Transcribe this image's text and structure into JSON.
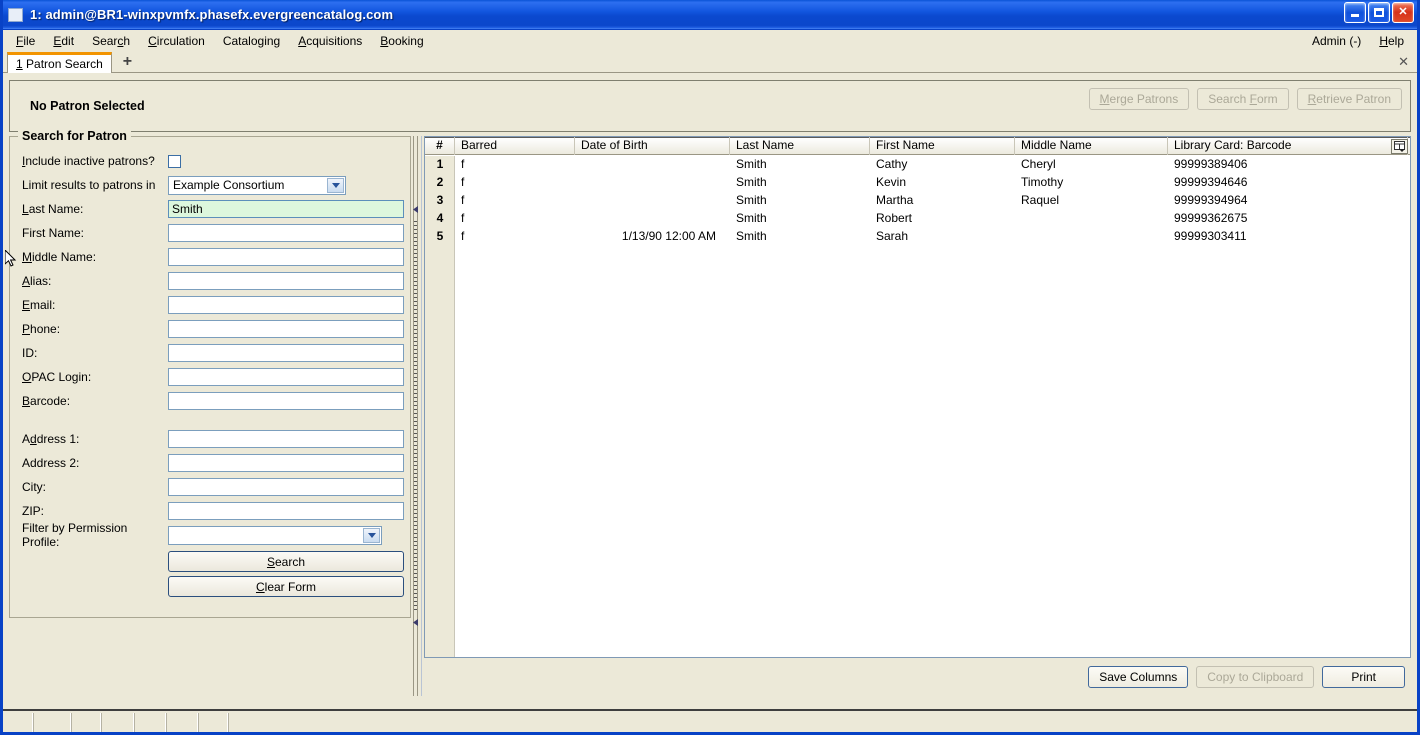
{
  "window": {
    "title": "1: admin@BR1-winxpvmfx.phasefx.evergreencatalog.com",
    "minimize_label": "Minimize",
    "maximize_label": "Maximize",
    "close_label": "✕"
  },
  "menubar": {
    "items": [
      {
        "label": "File",
        "accel": "F"
      },
      {
        "label": "Edit",
        "accel": "E"
      },
      {
        "label": "Search",
        "accel": "c"
      },
      {
        "label": "Circulation",
        "accel": "C"
      },
      {
        "label": "Cataloging",
        "accel": "g"
      },
      {
        "label": "Acquisitions",
        "accel": "A"
      },
      {
        "label": "Booking",
        "accel": "B"
      }
    ],
    "right": [
      {
        "label": "Admin (-)"
      },
      {
        "label": "Help",
        "accel": "H"
      }
    ]
  },
  "tabs": {
    "active": {
      "number": "1",
      "label": "Patron Search"
    },
    "new_tab_label": "+",
    "close_label": "✕"
  },
  "patron_header": {
    "status": "No Patron Selected",
    "buttons": [
      {
        "label": "Merge Patrons",
        "accel": "M",
        "enabled": false
      },
      {
        "label": "Search Form",
        "accel": "F",
        "enabled": false
      },
      {
        "label": "Retrieve Patron",
        "accel": "R",
        "enabled": false
      }
    ]
  },
  "search_form": {
    "legend": "Search for Patron",
    "fields": {
      "include_inactive": {
        "label": "Include inactive patrons?",
        "accel": "I",
        "type": "checkbox",
        "checked": false
      },
      "limit_org": {
        "label": "Limit results to patrons in",
        "type": "select",
        "value": "Example Consortium"
      },
      "last_name": {
        "label": "Last Name:",
        "accel": "L",
        "value": "Smith",
        "focused": true
      },
      "first_name": {
        "label": "First Name:",
        "value": ""
      },
      "middle_name": {
        "label": "Middle Name:",
        "accel": "M",
        "value": ""
      },
      "alias": {
        "label": "Alias:",
        "accel": "A",
        "value": ""
      },
      "email": {
        "label": "Email:",
        "accel": "E",
        "value": ""
      },
      "phone": {
        "label": "Phone:",
        "accel": "P",
        "value": ""
      },
      "id": {
        "label": "ID:",
        "value": ""
      },
      "opac_login": {
        "label": "OPAC Login:",
        "accel": "O",
        "value": ""
      },
      "barcode": {
        "label": "Barcode:",
        "accel": "B",
        "value": ""
      },
      "address1": {
        "label": "Address 1:",
        "accel": "d",
        "value": ""
      },
      "address2": {
        "label": "Address 2:",
        "value": ""
      },
      "city": {
        "label": "City:",
        "value": ""
      },
      "zip": {
        "label": "ZIP:",
        "value": ""
      },
      "permission_profile": {
        "label": "Filter by Permission Profile:",
        "type": "select",
        "value": ""
      }
    },
    "buttons": {
      "search": {
        "label": "Search",
        "accel": "S"
      },
      "clear": {
        "label": "Clear Form",
        "accel": "C"
      }
    }
  },
  "results": {
    "columns": [
      "#",
      "Barred",
      "Date of Birth",
      "Last Name",
      "First Name",
      "Middle Name",
      "Library Card: Barcode"
    ],
    "column_picker_label": "Column picker",
    "rows": [
      {
        "num": "1",
        "barred": "f",
        "dob": "",
        "last": "Smith",
        "first": "Cathy",
        "middle": "Cheryl",
        "card": "99999389406"
      },
      {
        "num": "2",
        "barred": "f",
        "dob": "",
        "last": "Smith",
        "first": "Kevin",
        "middle": "Timothy",
        "card": "99999394646"
      },
      {
        "num": "3",
        "barred": "f",
        "dob": "",
        "last": "Smith",
        "first": "Martha",
        "middle": "Raquel",
        "card": "99999394964"
      },
      {
        "num": "4",
        "barred": "f",
        "dob": "",
        "last": "Smith",
        "first": "Robert",
        "middle": "",
        "card": "99999362675"
      },
      {
        "num": "5",
        "barred": "f",
        "dob": "1/13/90 12:00 AM",
        "last": "Smith",
        "first": "Sarah",
        "middle": "",
        "card": "99999303411"
      }
    ],
    "footer_buttons": [
      {
        "label": "Save Columns",
        "enabled": true
      },
      {
        "label": "Copy to Clipboard",
        "enabled": false
      },
      {
        "label": "Print",
        "enabled": true
      }
    ]
  },
  "colors": {
    "titlebar_blue": "#0b49cf",
    "window_face": "#ece9d8",
    "field_focus_green": "#ddf7dd",
    "tab_accent_orange": "#f29400",
    "field_border": "#7b9ebd"
  }
}
